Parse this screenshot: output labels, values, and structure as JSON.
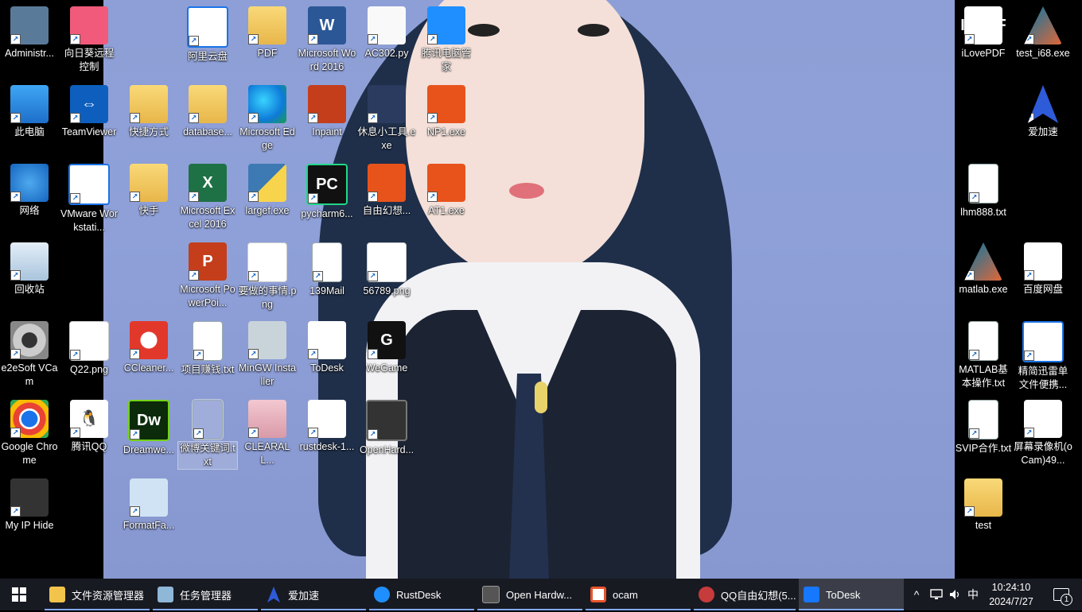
{
  "desktop": {
    "icons": [
      {
        "label": "Administr...",
        "icon": "admin-icon"
      },
      {
        "label": "向日葵远程控制",
        "icon": "sunlogin-icon"
      },
      {
        "label": "阿里云盘",
        "icon": "aliyun-drive-icon"
      },
      {
        "label": "PDF",
        "icon": "folder-icon"
      },
      {
        "label": "Microsoft Word 2016",
        "icon": "word-icon",
        "glyph": "W"
      },
      {
        "label": "AC302.py",
        "icon": "notepad-icon"
      },
      {
        "label": "腾讯电脑管家",
        "icon": "tencent-pc-manager-icon"
      },
      {
        "label": "iLovePDF",
        "icon": "ilovepdf-icon",
        "glyph": "I♥PDF"
      },
      {
        "label": "test_i68.exe",
        "icon": "matlab-icon"
      },
      {
        "label": "此电脑",
        "icon": "this-pc-icon"
      },
      {
        "label": "TeamViewer",
        "icon": "teamviewer-icon",
        "glyph": "⇔"
      },
      {
        "label": "快捷方式",
        "icon": "folder-icon"
      },
      {
        "label": "database...",
        "icon": "folder-icon"
      },
      {
        "label": "Microsoft Edge",
        "icon": "edge-icon"
      },
      {
        "label": "Inpaint",
        "icon": "inpaint-icon"
      },
      {
        "label": "休息小工具.exe",
        "icon": "rabbit-icon"
      },
      {
        "label": "NP1.exe",
        "icon": "fox-icon"
      },
      {
        "label": "爱加速",
        "icon": "rocket-icon"
      },
      {
        "label": "网络",
        "icon": "network-icon"
      },
      {
        "label": "VMware Workstati...",
        "icon": "vmware-icon"
      },
      {
        "label": "快手",
        "icon": "folder-icon"
      },
      {
        "label": "Microsoft Excel 2016",
        "icon": "excel-icon",
        "glyph": "X"
      },
      {
        "label": "largef.exe",
        "icon": "python-icon"
      },
      {
        "label": "pycharm6...",
        "icon": "pycharm-icon",
        "glyph": "PC"
      },
      {
        "label": "自由幻想...",
        "icon": "game-icon"
      },
      {
        "label": "AT1.exe",
        "icon": "fox-icon"
      },
      {
        "label": "lhm888.txt",
        "icon": "text-file-icon"
      },
      {
        "label": "回收站",
        "icon": "recycle-bin-icon"
      },
      {
        "label": "Microsoft PowerPoi...",
        "icon": "powerpoint-icon",
        "glyph": "P"
      },
      {
        "label": "要做的事情.png",
        "icon": "image-file-icon"
      },
      {
        "label": "139Mail",
        "icon": "text-file-icon"
      },
      {
        "label": "56789.png",
        "icon": "image-file-icon"
      },
      {
        "label": "matlab.exe",
        "icon": "matlab-icon"
      },
      {
        "label": "百度网盘",
        "icon": "baidu-netdisk-icon"
      },
      {
        "label": "e2eSoft VCam",
        "icon": "webcam-icon"
      },
      {
        "label": "Q22.png",
        "icon": "image-file-icon"
      },
      {
        "label": "CCleaner...",
        "icon": "ccleaner-icon"
      },
      {
        "label": "项目赚钱.txt",
        "icon": "text-file-icon"
      },
      {
        "label": "MinGW Installer",
        "icon": "mingw-icon"
      },
      {
        "label": "ToDesk",
        "icon": "todesk-icon",
        "glyph": "T"
      },
      {
        "label": "WeGame",
        "icon": "wegame-icon",
        "glyph": "G"
      },
      {
        "label": "MATLAB基本操作.txt",
        "icon": "text-file-icon"
      },
      {
        "label": "精简迅雷单文件便携...",
        "icon": "thunder-icon"
      },
      {
        "label": "Google Chrome",
        "icon": "chrome-icon"
      },
      {
        "label": "腾讯QQ",
        "icon": "qq-icon",
        "glyph": "🐧"
      },
      {
        "label": "Dreamwe...",
        "icon": "dreamweaver-icon",
        "glyph": "Dw"
      },
      {
        "label": "微博关键词.txt",
        "icon": "text-file-icon"
      },
      {
        "label": "CLEARALL...",
        "icon": "photo-icon"
      },
      {
        "label": "rustdesk-1...",
        "icon": "rustdesk-icon",
        "glyph": "↻"
      },
      {
        "label": "OpenHard...",
        "icon": "openhardware-icon"
      },
      {
        "label": "SVIP合作.txt",
        "icon": "text-file-icon"
      },
      {
        "label": "屏幕录像机(oCam)49...",
        "icon": "ocam-icon",
        "glyph": "●"
      },
      {
        "label": "My IP Hide",
        "icon": "spy-icon"
      },
      {
        "label": "FormatFa...",
        "icon": "formatfactory-icon"
      },
      {
        "label": "test",
        "icon": "folder-icon"
      }
    ]
  },
  "taskbar": {
    "items": [
      {
        "label": "文件资源管理器",
        "icon": "file-explorer-icon"
      },
      {
        "label": "任务管理器",
        "icon": "task-manager-icon"
      },
      {
        "label": "爱加速",
        "icon": "rocket-icon"
      },
      {
        "label": "RustDesk",
        "icon": "rustdesk-icon"
      },
      {
        "label": "Open Hardw...",
        "icon": "openhardware-icon"
      },
      {
        "label": "ocam",
        "icon": "ocam-icon"
      },
      {
        "label": "QQ自由幻想(5...",
        "icon": "game-icon"
      },
      {
        "label": "ToDesk",
        "icon": "todesk-icon"
      }
    ],
    "tray": {
      "chevron": "^",
      "ime": "中",
      "time": "10:24:10",
      "date": "2024/7/27",
      "notifications": "1"
    }
  },
  "colors": {
    "taskbar": "#181a22",
    "accent": "#7fa9ff",
    "wallpaper": "#8d9fd6"
  }
}
